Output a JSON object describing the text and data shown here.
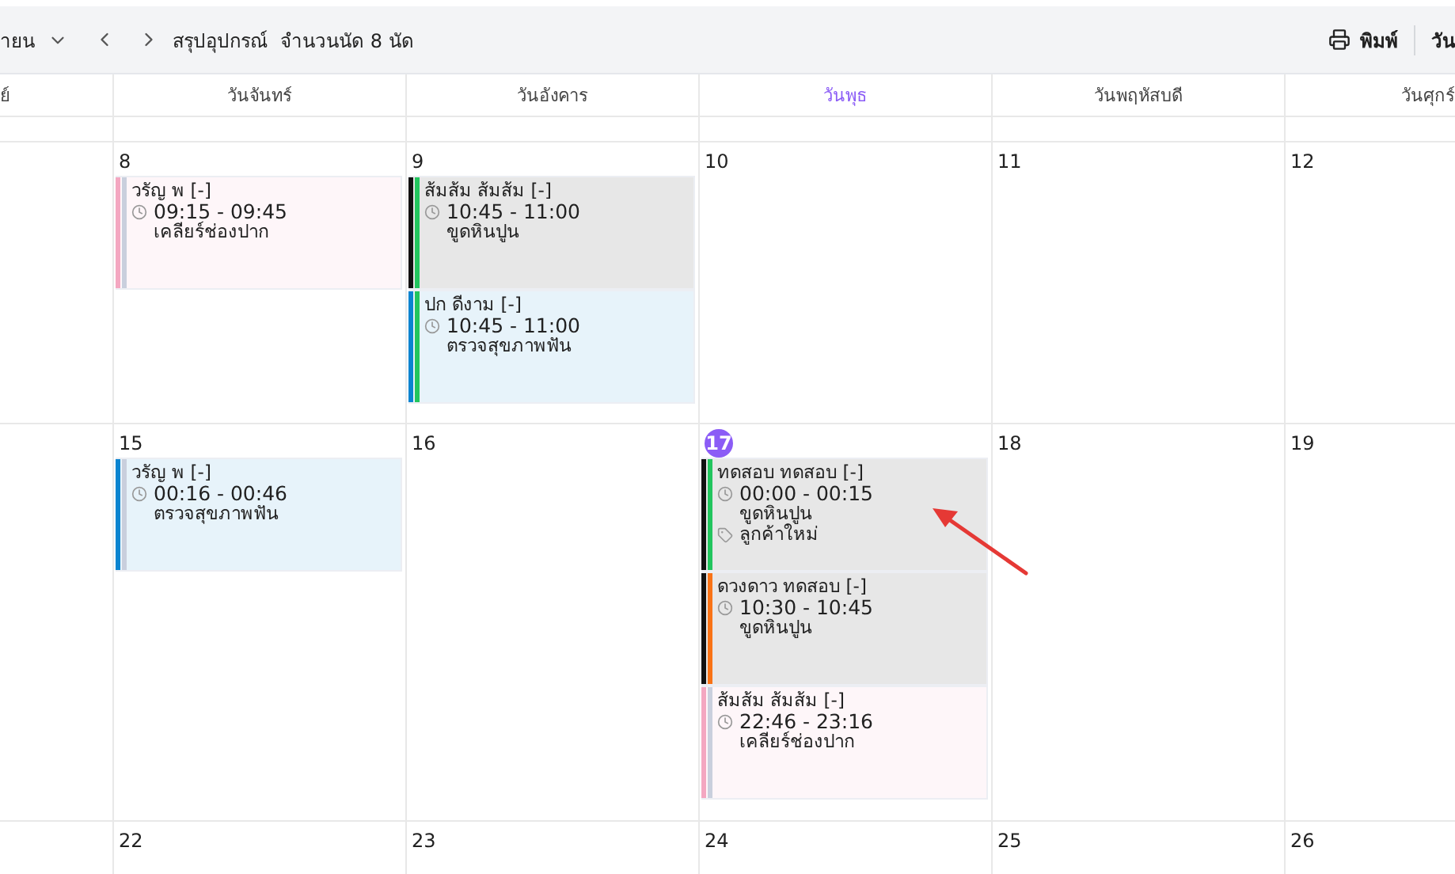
{
  "toolbar": {
    "month": "ายน",
    "summary": "สรุปอุปกรณ์",
    "count": "จำนวนนัด 8 นัด",
    "print": "พิมพ์",
    "view": "วัน"
  },
  "weekdays": [
    {
      "label": "ย์",
      "selected": false
    },
    {
      "label": "วันจันทร์",
      "selected": false
    },
    {
      "label": "วันอังคาร",
      "selected": false
    },
    {
      "label": "วันพุธ",
      "selected": true
    },
    {
      "label": "วันพฤหัสบดี",
      "selected": false
    },
    {
      "label": "วันศุกร์",
      "selected": false
    }
  ],
  "weeks": [
    {
      "days": [
        {
          "number": "8",
          "today": false,
          "events": [
            {
              "name": "วรัญ พ [-]",
              "time": "09:15 - 09:45",
              "service": "เคลียร์ช่องปาก",
              "color": "#f4a7c1",
              "kind": "waiting"
            }
          ]
        },
        {
          "number": "9",
          "today": false,
          "events": [
            {
              "name": "ส้มส้ม ส้มส้ม [-]",
              "time": "10:45 - 11:00",
              "service": "ขูดหินปูน",
              "color": "#111111",
              "kind": "confirmed"
            },
            {
              "name": "ปก ดีงาม [-]",
              "time": "10:45 - 11:00",
              "service": "ตรวจสุขภาพฟัน",
              "color": "#0a84d0",
              "kind": "confirmed"
            }
          ]
        },
        {
          "number": "10",
          "today": false
        },
        {
          "number": "11",
          "today": false
        },
        {
          "number": "12",
          "today": false
        }
      ]
    },
    {
      "days": [
        {
          "number": "15",
          "today": false,
          "events": [
            {
              "name": "วรัญ พ [-]",
              "time": "00:16 - 00:46",
              "service": "ตรวจสุขภาพฟัน",
              "color": "#0a84d0",
              "kind": "waiting"
            }
          ]
        },
        {
          "number": "16",
          "today": false
        },
        {
          "number": "17",
          "today": true,
          "events": [
            {
              "name": "ทดสอบ ทดสอบ [-]",
              "time": "00:00 - 00:15",
              "service": "ขูดหินปูน",
              "tag": "ลูกค้าใหม่",
              "color": "#111111",
              "kind": "confirmed"
            },
            {
              "name": "ดวงดาว ทดสอบ [-]",
              "time": "10:30 - 10:45",
              "service": "ขูดหินปูน",
              "color": "#111111",
              "kind": "in-progress"
            },
            {
              "name": "ส้มส้ม ส้มส้ม [-]",
              "time": "22:46 - 23:16",
              "service": "เคลียร์ช่องปาก",
              "color": "#f4a7c1",
              "kind": "waiting"
            }
          ]
        },
        {
          "number": "18",
          "today": false
        },
        {
          "number": "19",
          "today": false
        }
      ]
    },
    {
      "days": [
        {
          "number": "22",
          "today": false
        },
        {
          "number": "23",
          "today": false
        },
        {
          "number": "24",
          "today": false
        },
        {
          "number": "25",
          "today": false
        },
        {
          "number": "26",
          "today": false
        }
      ]
    }
  ]
}
